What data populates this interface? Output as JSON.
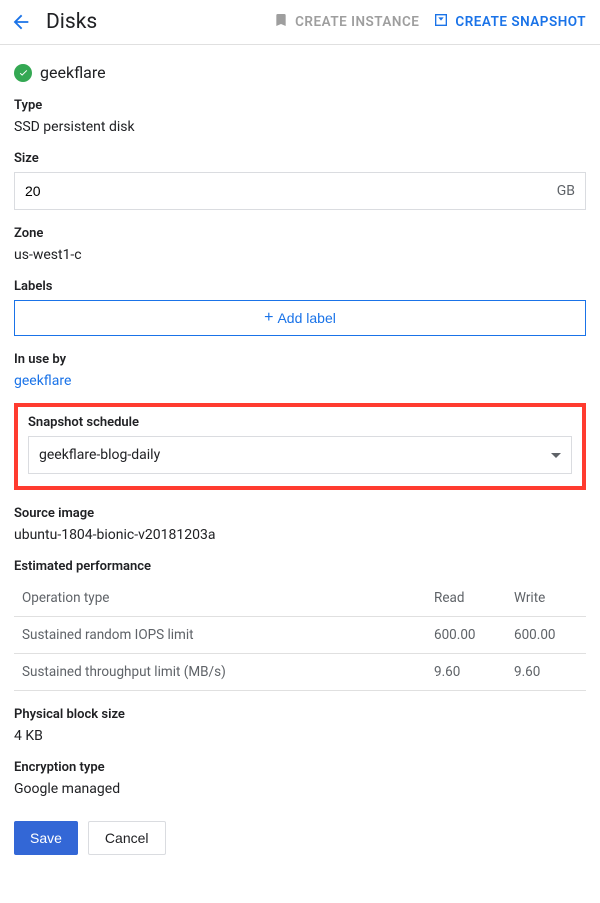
{
  "header": {
    "title": "Disks",
    "create_instance": "CREATE INSTANCE",
    "create_snapshot": "CREATE SNAPSHOT"
  },
  "disk": {
    "name": "geekflare",
    "type_label": "Type",
    "type_value": "SSD persistent disk",
    "size_label": "Size",
    "size_value": "20",
    "size_unit": "GB",
    "zone_label": "Zone",
    "zone_value": "us-west1-c",
    "labels_label": "Labels",
    "add_label_text": "Add label",
    "in_use_by_label": "In use by",
    "in_use_by_value": "geekflare",
    "snapshot_schedule_label": "Snapshot schedule",
    "snapshot_schedule_value": "geekflare-blog-daily",
    "source_image_label": "Source image",
    "source_image_value": "ubuntu-1804-bionic-v20181203a",
    "estimated_perf_label": "Estimated performance",
    "perf_headers": {
      "op": "Operation type",
      "read": "Read",
      "write": "Write"
    },
    "perf_rows": [
      {
        "op": "Sustained random IOPS limit",
        "read": "600.00",
        "write": "600.00"
      },
      {
        "op": "Sustained throughput limit (MB/s)",
        "read": "9.60",
        "write": "9.60"
      }
    ],
    "block_size_label": "Physical block size",
    "block_size_value": "4 KB",
    "encryption_label": "Encryption type",
    "encryption_value": "Google managed"
  },
  "actions": {
    "save": "Save",
    "cancel": "Cancel"
  }
}
